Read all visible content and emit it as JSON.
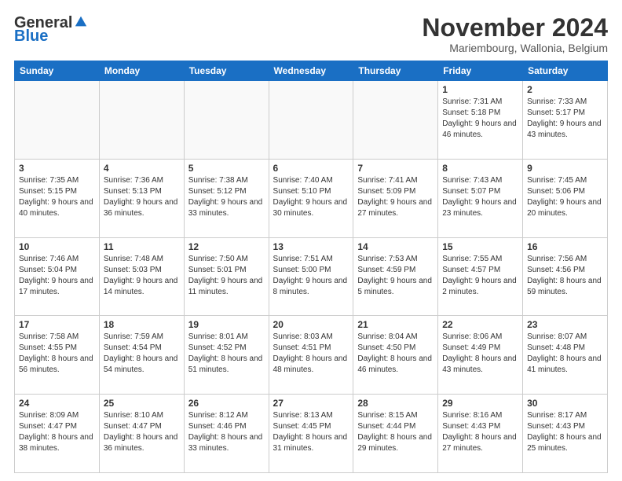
{
  "logo": {
    "general": "General",
    "blue": "Blue"
  },
  "header": {
    "title": "November 2024",
    "location": "Mariembourg, Wallonia, Belgium"
  },
  "weekdays": [
    "Sunday",
    "Monday",
    "Tuesday",
    "Wednesday",
    "Thursday",
    "Friday",
    "Saturday"
  ],
  "weeks": [
    [
      {
        "day": "",
        "info": ""
      },
      {
        "day": "",
        "info": ""
      },
      {
        "day": "",
        "info": ""
      },
      {
        "day": "",
        "info": ""
      },
      {
        "day": "",
        "info": ""
      },
      {
        "day": "1",
        "info": "Sunrise: 7:31 AM\nSunset: 5:18 PM\nDaylight: 9 hours and 46 minutes."
      },
      {
        "day": "2",
        "info": "Sunrise: 7:33 AM\nSunset: 5:17 PM\nDaylight: 9 hours and 43 minutes."
      }
    ],
    [
      {
        "day": "3",
        "info": "Sunrise: 7:35 AM\nSunset: 5:15 PM\nDaylight: 9 hours and 40 minutes."
      },
      {
        "day": "4",
        "info": "Sunrise: 7:36 AM\nSunset: 5:13 PM\nDaylight: 9 hours and 36 minutes."
      },
      {
        "day": "5",
        "info": "Sunrise: 7:38 AM\nSunset: 5:12 PM\nDaylight: 9 hours and 33 minutes."
      },
      {
        "day": "6",
        "info": "Sunrise: 7:40 AM\nSunset: 5:10 PM\nDaylight: 9 hours and 30 minutes."
      },
      {
        "day": "7",
        "info": "Sunrise: 7:41 AM\nSunset: 5:09 PM\nDaylight: 9 hours and 27 minutes."
      },
      {
        "day": "8",
        "info": "Sunrise: 7:43 AM\nSunset: 5:07 PM\nDaylight: 9 hours and 23 minutes."
      },
      {
        "day": "9",
        "info": "Sunrise: 7:45 AM\nSunset: 5:06 PM\nDaylight: 9 hours and 20 minutes."
      }
    ],
    [
      {
        "day": "10",
        "info": "Sunrise: 7:46 AM\nSunset: 5:04 PM\nDaylight: 9 hours and 17 minutes."
      },
      {
        "day": "11",
        "info": "Sunrise: 7:48 AM\nSunset: 5:03 PM\nDaylight: 9 hours and 14 minutes."
      },
      {
        "day": "12",
        "info": "Sunrise: 7:50 AM\nSunset: 5:01 PM\nDaylight: 9 hours and 11 minutes."
      },
      {
        "day": "13",
        "info": "Sunrise: 7:51 AM\nSunset: 5:00 PM\nDaylight: 9 hours and 8 minutes."
      },
      {
        "day": "14",
        "info": "Sunrise: 7:53 AM\nSunset: 4:59 PM\nDaylight: 9 hours and 5 minutes."
      },
      {
        "day": "15",
        "info": "Sunrise: 7:55 AM\nSunset: 4:57 PM\nDaylight: 9 hours and 2 minutes."
      },
      {
        "day": "16",
        "info": "Sunrise: 7:56 AM\nSunset: 4:56 PM\nDaylight: 8 hours and 59 minutes."
      }
    ],
    [
      {
        "day": "17",
        "info": "Sunrise: 7:58 AM\nSunset: 4:55 PM\nDaylight: 8 hours and 56 minutes."
      },
      {
        "day": "18",
        "info": "Sunrise: 7:59 AM\nSunset: 4:54 PM\nDaylight: 8 hours and 54 minutes."
      },
      {
        "day": "19",
        "info": "Sunrise: 8:01 AM\nSunset: 4:52 PM\nDaylight: 8 hours and 51 minutes."
      },
      {
        "day": "20",
        "info": "Sunrise: 8:03 AM\nSunset: 4:51 PM\nDaylight: 8 hours and 48 minutes."
      },
      {
        "day": "21",
        "info": "Sunrise: 8:04 AM\nSunset: 4:50 PM\nDaylight: 8 hours and 46 minutes."
      },
      {
        "day": "22",
        "info": "Sunrise: 8:06 AM\nSunset: 4:49 PM\nDaylight: 8 hours and 43 minutes."
      },
      {
        "day": "23",
        "info": "Sunrise: 8:07 AM\nSunset: 4:48 PM\nDaylight: 8 hours and 41 minutes."
      }
    ],
    [
      {
        "day": "24",
        "info": "Sunrise: 8:09 AM\nSunset: 4:47 PM\nDaylight: 8 hours and 38 minutes."
      },
      {
        "day": "25",
        "info": "Sunrise: 8:10 AM\nSunset: 4:47 PM\nDaylight: 8 hours and 36 minutes."
      },
      {
        "day": "26",
        "info": "Sunrise: 8:12 AM\nSunset: 4:46 PM\nDaylight: 8 hours and 33 minutes."
      },
      {
        "day": "27",
        "info": "Sunrise: 8:13 AM\nSunset: 4:45 PM\nDaylight: 8 hours and 31 minutes."
      },
      {
        "day": "28",
        "info": "Sunrise: 8:15 AM\nSunset: 4:44 PM\nDaylight: 8 hours and 29 minutes."
      },
      {
        "day": "29",
        "info": "Sunrise: 8:16 AM\nSunset: 4:43 PM\nDaylight: 8 hours and 27 minutes."
      },
      {
        "day": "30",
        "info": "Sunrise: 8:17 AM\nSunset: 4:43 PM\nDaylight: 8 hours and 25 minutes."
      }
    ]
  ]
}
